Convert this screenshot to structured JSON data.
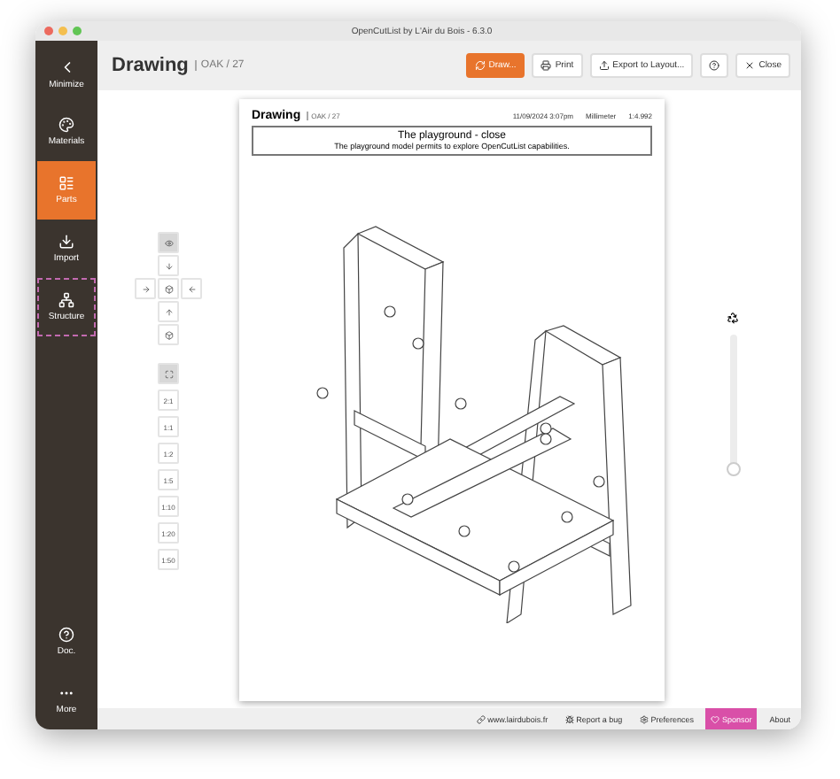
{
  "window": {
    "title": "OpenCutList by L'Air du Bois - 6.3.0"
  },
  "sidebar": {
    "items": [
      {
        "kind": "minimize",
        "label": "Minimize",
        "selected": false,
        "highlighted": false
      },
      {
        "kind": "materials",
        "label": "Materials",
        "selected": false,
        "highlighted": false
      },
      {
        "kind": "parts",
        "label": "Parts",
        "selected": true,
        "highlighted": false
      },
      {
        "kind": "import",
        "label": "Import",
        "selected": false,
        "highlighted": false
      },
      {
        "kind": "structure",
        "label": "Structure",
        "selected": false,
        "highlighted": true
      }
    ],
    "bottom_items": [
      {
        "kind": "doc",
        "label": "Doc."
      },
      {
        "kind": "more",
        "label": "More"
      }
    ]
  },
  "header": {
    "title": "Drawing",
    "subtitle": "OAK / 27",
    "buttons": [
      {
        "kind": "draw",
        "label": "Draw...",
        "primary": true
      },
      {
        "kind": "print",
        "label": "Print",
        "primary": false
      },
      {
        "kind": "export",
        "label": "Export to Layout...",
        "primary": false
      },
      {
        "kind": "help",
        "primary": false
      },
      {
        "kind": "close",
        "label": "Close",
        "primary": false
      }
    ]
  },
  "view_controls": {
    "views": [
      {
        "kind": "iso",
        "selected": true
      },
      {
        "kind": "top",
        "selected": false
      },
      {
        "kind": "left",
        "selected": false
      },
      {
        "kind": "front",
        "selected": false
      },
      {
        "kind": "right",
        "selected": false
      },
      {
        "kind": "bottom",
        "selected": false
      },
      {
        "kind": "back",
        "selected": false
      }
    ],
    "scales": [
      {
        "kind": "fit",
        "selected": true
      },
      {
        "label": "2:1",
        "kind": "scale",
        "selected": false
      },
      {
        "label": "1:1",
        "kind": "scale",
        "selected": false
      },
      {
        "label": "1:2",
        "kind": "scale",
        "selected": false
      },
      {
        "label": "1:5",
        "kind": "scale",
        "selected": false
      },
      {
        "label": "1:10",
        "kind": "scale",
        "selected": false
      },
      {
        "label": "1:20",
        "kind": "scale",
        "selected": false
      },
      {
        "label": "1:50",
        "kind": "scale",
        "selected": false
      }
    ]
  },
  "paper": {
    "title": "Drawing",
    "subtitle": "OAK / 27",
    "date": "11/09/2024 3:07pm",
    "unit": "Millimeter",
    "scale": "1:4.992",
    "model_name": "The playground - close",
    "model_description": "The playground model permits to explore OpenCutList capabilities."
  },
  "zoom_slider": {
    "level": 0
  },
  "footer": [
    {
      "kind": "link",
      "label": "www.lairdubois.fr"
    },
    {
      "kind": "bug",
      "label": "Report a bug"
    },
    {
      "kind": "prefs",
      "label": "Preferences"
    },
    {
      "kind": "sponsor",
      "label": "Sponsor"
    },
    {
      "kind": "plain",
      "label": "About"
    }
  ]
}
